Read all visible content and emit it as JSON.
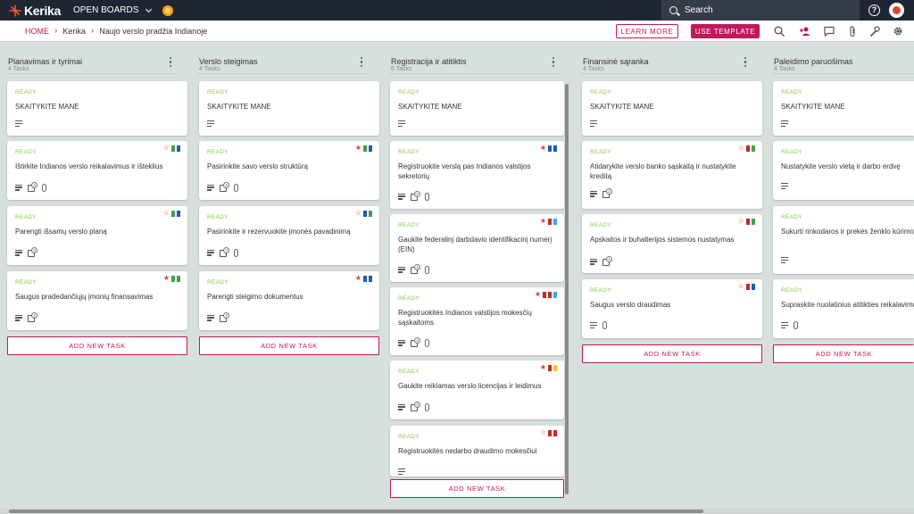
{
  "topbar": {
    "logo_text": "Kerika",
    "boards_menu_label": "OPEN BOARDS",
    "search_placeholder": "Search"
  },
  "subbar": {
    "breadcrumb": [
      "HOME",
      "Kerika",
      "Naujo verslo pradžia Indianoje"
    ],
    "learn_more": "LEARN MORE",
    "use_template": "USE TEMPLATE"
  },
  "colors": {
    "accent": "#c2185b",
    "ready": "#8bc34a",
    "topbar": "#1f2532",
    "board_bg": "#d8e0dd",
    "tag_green": "#43a047",
    "tag_blue": "#1e5bb8",
    "tag_red": "#c62828",
    "tag_lightblue": "#42a5f5",
    "tag_yellow": "#fbc02d"
  },
  "add_task_label": "ADD NEW TASK",
  "columns": [
    {
      "title": "Planavimas ir tyrimai",
      "count": "4 Tasks",
      "cards": [
        {
          "status": "READY",
          "title": "SKAITYKITE MANE"
        },
        {
          "status": "READY",
          "title": "Ištirkite Indianos verslo reikalavimus ir išteklius",
          "checklist": "3"
        },
        {
          "status": "READY",
          "title": "Parengti išsamų verslo planą",
          "checklist": "3"
        },
        {
          "status": "READY",
          "title": "Saugus pradedančiųjų įmonių finansavimas",
          "checklist": "3"
        }
      ]
    },
    {
      "title": "Verslo steigimas",
      "count": "4 Tasks",
      "cards": [
        {
          "status": "READY",
          "title": "SKAITYKITE MANE"
        },
        {
          "status": "READY",
          "title": "Pasirinkite savo verslo struktūrą",
          "checklist": "3"
        },
        {
          "status": "READY",
          "title": "Pasirinkite ir rezervuokite įmonės pavadinimą",
          "checklist": "3"
        },
        {
          "status": "READY",
          "title": "Parengti steigimo dokumentus",
          "checklist": "3"
        }
      ]
    },
    {
      "title": "Registracija ir atitiktis",
      "count": "6 Tasks",
      "cards": [
        {
          "status": "READY",
          "title": "SKAITYKITE MANE"
        },
        {
          "status": "READY",
          "title": "Registruokite verslą pas Indianos valstijos sekretorių",
          "checklist": "3"
        },
        {
          "status": "READY",
          "title": "Gaukite federalinį darbdavio identifikacinį numerį (EIN)",
          "checklist": "3"
        },
        {
          "status": "READY",
          "title": "Registruokitės Indianos valstijos mokesčių sąskaitoms",
          "checklist": "3"
        },
        {
          "status": "READY",
          "title": "Gaukite reikiamas verslo licencijas ir leidimus",
          "checklist": "3"
        },
        {
          "status": "READY",
          "title": "Registruokitės nedarbo draudimo mokesčiui"
        }
      ]
    },
    {
      "title": "Finansinė sąranka",
      "count": "4 Tasks",
      "cards": [
        {
          "status": "READY",
          "title": "SKAITYKITE MANE"
        },
        {
          "status": "READY",
          "title": "Atidarykite verslo banko sąskaitą ir nustatykite kreditą",
          "checklist": "3"
        },
        {
          "status": "READY",
          "title": "Apskaitos ir buhalterijos sistemos nustatymas",
          "checklist": "3"
        },
        {
          "status": "READY",
          "title": "Saugus verslo draudimas"
        }
      ]
    },
    {
      "title": "Paleidimo paruošimas",
      "count": "4 Tasks",
      "cards": [
        {
          "status": "READY",
          "title": "SKAITYKITE MANE"
        },
        {
          "status": "READY",
          "title": "Nustatykite verslo vietą ir darbo erdvę"
        },
        {
          "status": "READY",
          "title": "Sukurti rinkodaros ir prekės ženklo kūrimo strategiją"
        },
        {
          "status": "READY",
          "title": "Supraskite nuolatinius atitikties reikalavimus"
        }
      ]
    }
  ]
}
